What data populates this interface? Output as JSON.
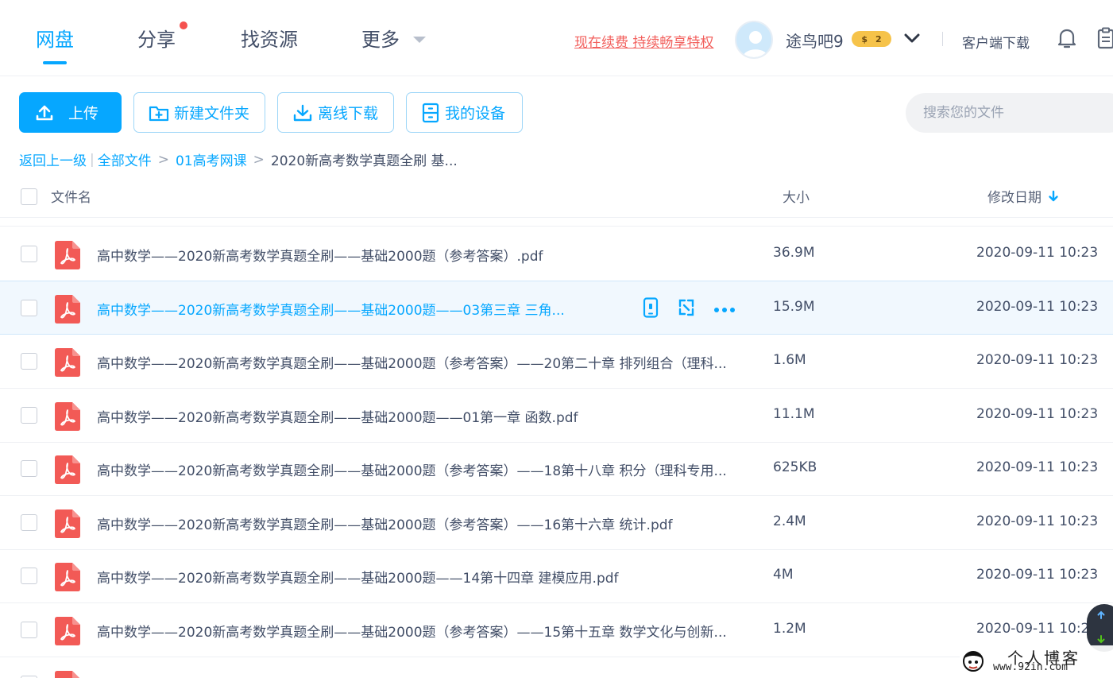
{
  "nav": {
    "tabs": [
      {
        "label": "网盘"
      },
      {
        "label": "分享"
      },
      {
        "label": "找资源"
      },
      {
        "label": "更多"
      }
    ],
    "promo": "现在续费 持续畅享特权",
    "username": "途鸟吧9",
    "coin_symbol": "$",
    "coin_count": "2",
    "client_download": "客户端下载"
  },
  "toolbar": {
    "upload": "上传",
    "new_folder": "新建文件夹",
    "offline_download": "离线下载",
    "my_devices": "我的设备"
  },
  "search": {
    "placeholder": "搜索您的文件"
  },
  "breadcrumb": {
    "back": "返回上一级",
    "all_files": "全部文件",
    "folder": "01高考网课",
    "current": "2020新高考数学真题全刷 基..."
  },
  "table": {
    "headers": {
      "name": "文件名",
      "size": "大小",
      "date": "修改日期"
    },
    "rows": [
      {
        "name": "高中数学——2020新高考数学真题全刷——基础2000题（参考答案）.pdf",
        "size": "36.9M",
        "date": "2020-09-11 10:23"
      },
      {
        "name": "高中数学——2020新高考数学真题全刷——基础2000题——03第三章 三角...",
        "size": "15.9M",
        "date": "2020-09-11 10:23"
      },
      {
        "name": "高中数学——2020新高考数学真题全刷——基础2000题（参考答案）——20第二十章 排列组合（理科...",
        "size": "1.6M",
        "date": "2020-09-11 10:23"
      },
      {
        "name": "高中数学——2020新高考数学真题全刷——基础2000题——01第一章 函数.pdf",
        "size": "11.1M",
        "date": "2020-09-11 10:23"
      },
      {
        "name": "高中数学——2020新高考数学真题全刷——基础2000题（参考答案）——18第十八章 积分（理科专用...",
        "size": "625KB",
        "date": "2020-09-11 10:23"
      },
      {
        "name": "高中数学——2020新高考数学真题全刷——基础2000题（参考答案）——16第十六章 统计.pdf",
        "size": "2.4M",
        "date": "2020-09-11 10:23"
      },
      {
        "name": "高中数学——2020新高考数学真题全刷——基础2000题——14第十四章 建模应用.pdf",
        "size": "4M",
        "date": "2020-09-11 10:23"
      },
      {
        "name": "高中数学——2020新高考数学真题全刷——基础2000题（参考答案）——15第十五章 数学文化与创新...",
        "size": "1.2M",
        "date": "2020-09-11 10:23"
      }
    ]
  },
  "watermark": {
    "title": "个人博客",
    "url": "www.92in.com"
  },
  "colors": {
    "accent": "#06a7ff",
    "pdf": "#f25a56",
    "promo": "#f25f5c"
  }
}
